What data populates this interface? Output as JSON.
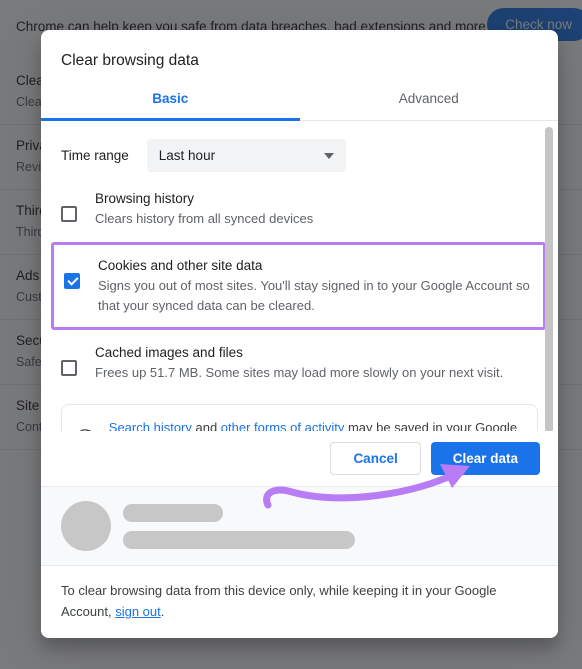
{
  "background": {
    "banner": {
      "text": "Chrome can help keep you safe from data breaches, bad extensions and more",
      "button_label": "Check now"
    },
    "rows": [
      {
        "title": "Clear browsing data",
        "subtitle": "Clear history, cookies, cache and more"
      },
      {
        "title": "Privacy Guide",
        "subtitle": "Review key privacy and security controls"
      },
      {
        "title": "Third-party cookies",
        "subtitle": "Third-party cookies are blocked"
      },
      {
        "title": "Ads privacy",
        "subtitle": "Customise the info used by sites to show you ads"
      },
      {
        "title": "Security",
        "subtitle": "Safe Browsing (protection from dangerous sites) and other security settings"
      },
      {
        "title": "Site settings",
        "subtitle": "Controls what information sites can use and show"
      }
    ]
  },
  "dialog": {
    "title": "Clear browsing data",
    "tabs": [
      {
        "label": "Basic",
        "active": true
      },
      {
        "label": "Advanced",
        "active": false
      }
    ],
    "time_range": {
      "label": "Time range",
      "value": "Last hour"
    },
    "options": [
      {
        "title": "Browsing history",
        "description": "Clears history from all synced devices",
        "checked": false
      },
      {
        "title": "Cookies and other site data",
        "description": "Signs you out of most sites. You'll stay signed in to your Google Account so that your synced data can be cleared.",
        "checked": true
      },
      {
        "title": "Cached images and files",
        "description": "Frees up 51.7 MB. Some sites may load more slowly on your next visit.",
        "checked": false
      }
    ],
    "info_card": {
      "icon_glyph": "G",
      "link1": "Search history",
      "text1": " and ",
      "link2": "other forms of activity",
      "text2": " may be saved in your Google Account when you're signed in. You can delete them at any"
    },
    "actions": {
      "cancel_label": "Cancel",
      "confirm_label": "Clear data"
    },
    "footer": {
      "text": "To clear browsing data from this device only, while keeping it in your Google Account, ",
      "link": "sign out",
      "text_end": "."
    }
  },
  "annotation": {
    "color": "#b87cf5",
    "highlight_target": "Cookies and other site data",
    "arrow_target": "Clear data"
  }
}
